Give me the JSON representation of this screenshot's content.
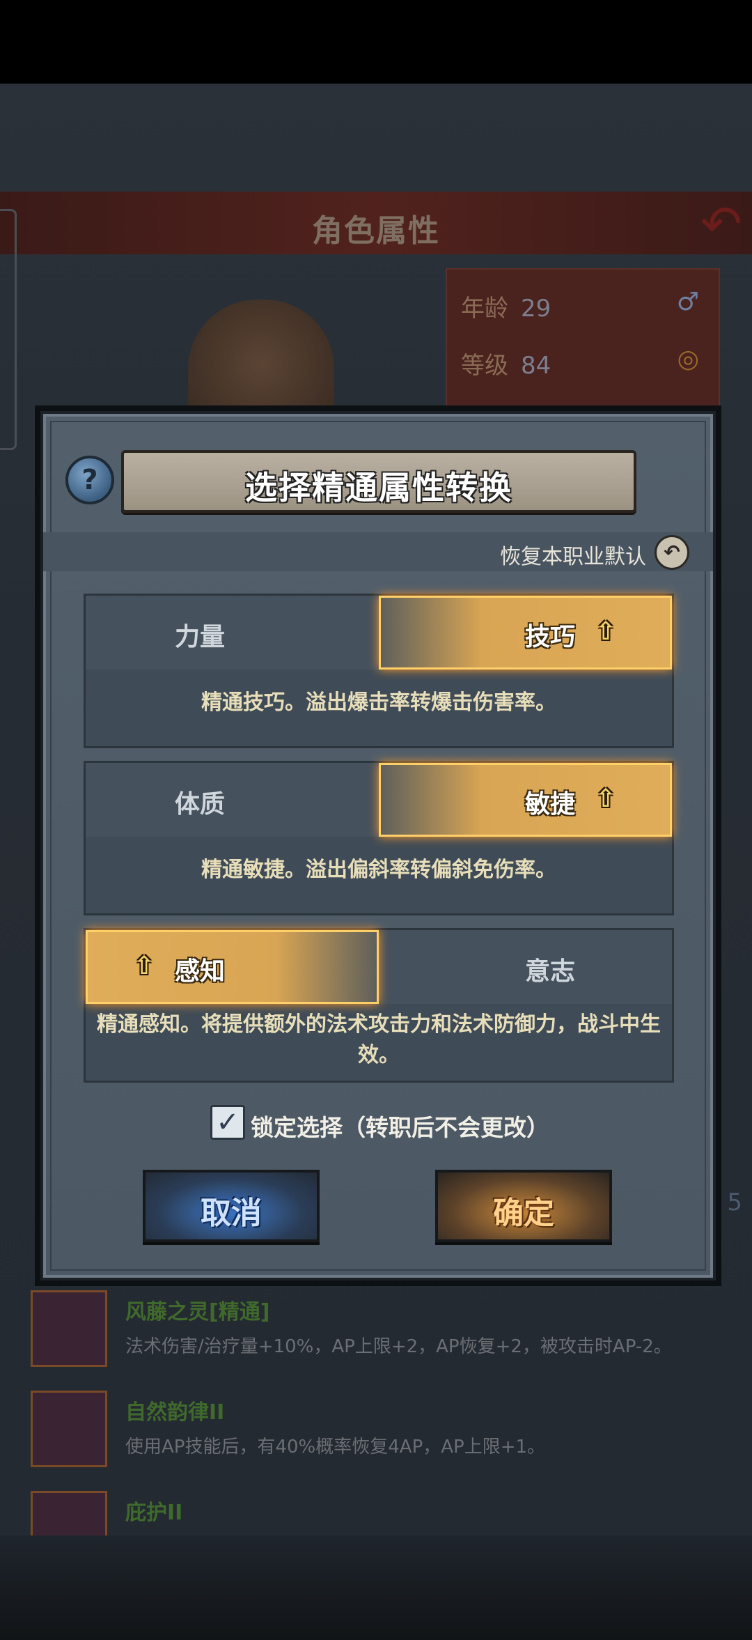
{
  "background": {
    "header_title": "角色属性",
    "info": [
      {
        "label": "年龄",
        "value": "29"
      },
      {
        "label": "等级",
        "value": "84"
      }
    ],
    "skills": [
      {
        "name": "风藤之灵[精通]",
        "desc": "法术伤害/治疗量+10%，AP上限+2，AP恢复+2，被攻击时AP-2。"
      },
      {
        "name": "自然韵律II",
        "desc": "使用AP技能后，有40%概率恢复4AP，AP上限+1。"
      },
      {
        "name": "庇护II",
        "desc": ""
      }
    ],
    "side_number": "5"
  },
  "dialog": {
    "title": "选择精通属性转换",
    "help_icon": "question-icon",
    "reset_label": "恢复本职业默认",
    "options": [
      {
        "left": "力量",
        "right": "技巧",
        "selected": "right",
        "desc": "精通技巧。溢出爆击率转爆击伤害率。"
      },
      {
        "left": "体质",
        "right": "敏捷",
        "selected": "right",
        "desc": "精通敏捷。溢出偏斜率转偏斜免伤率。"
      },
      {
        "left": "感知",
        "right": "意志",
        "selected": "left",
        "desc": "精通感知。将提供额外的法术攻击力和法术防御力，战斗中生效。"
      }
    ],
    "lock_label": "锁定选择（转职后不会更改）",
    "lock_checked": true,
    "cancel_label": "取消",
    "confirm_label": "确定"
  },
  "colors": {
    "selected_gold": "#e0ad5a",
    "desc_text": "#e8dfba",
    "cancel_blue": "#3f78c6",
    "confirm_orange": "#c98a3c"
  }
}
